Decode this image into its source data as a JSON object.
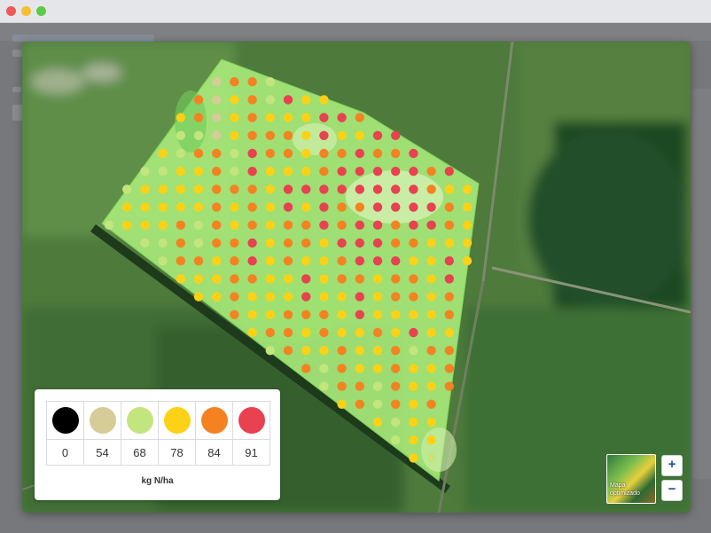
{
  "window": {
    "controls": [
      "close",
      "minimize",
      "maximize"
    ]
  },
  "legend": {
    "classes": [
      {
        "value": "0",
        "color": "#000000"
      },
      {
        "value": "54",
        "color": "#d6cc98"
      },
      {
        "value": "68",
        "color": "#c3e57e"
      },
      {
        "value": "78",
        "color": "#fcd116"
      },
      {
        "value": "84",
        "color": "#f58220"
      },
      {
        "value": "91",
        "color": "#e8414f"
      }
    ],
    "unit": "kg N/ha"
  },
  "map": {
    "minimap_label": "Mapa optimizado",
    "zoom_in_label": "+",
    "zoom_out_label": "−",
    "field_fill": "#a9ea7a"
  }
}
